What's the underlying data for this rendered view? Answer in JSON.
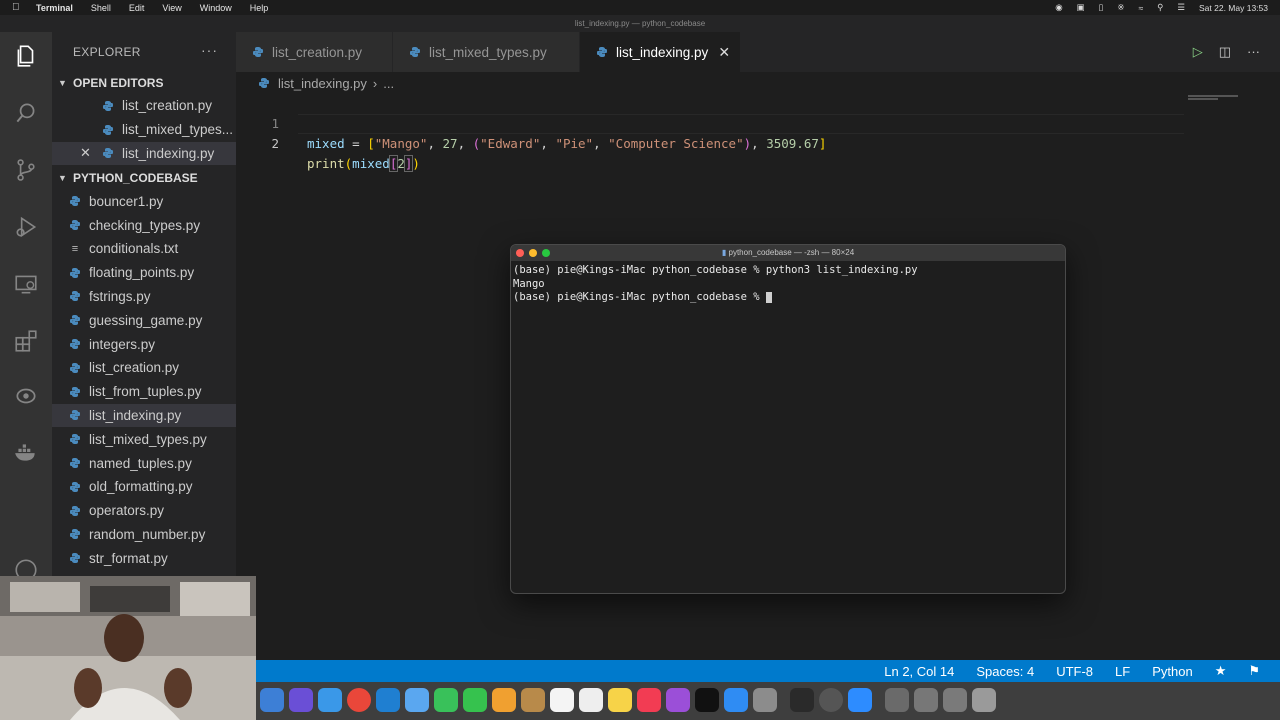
{
  "menubar": {
    "app_name": "Terminal",
    "items": [
      "Shell",
      "Edit",
      "View",
      "Window",
      "Help"
    ],
    "datetime": "Sat 22. May  13:53"
  },
  "window_title": "list_indexing.py — python_codebase",
  "sidebar": {
    "header": "EXPLORER",
    "open_editors_label": "OPEN EDITORS",
    "open_editors": [
      "list_creation.py",
      "list_mixed_types...",
      "list_indexing.py"
    ],
    "folder_label": "PYTHON_CODEBASE",
    "files": [
      {
        "name": "bouncer1.py",
        "icon": "python-icon"
      },
      {
        "name": "checking_types.py",
        "icon": "python-icon"
      },
      {
        "name": "conditionals.txt",
        "icon": "text-file-icon"
      },
      {
        "name": "floating_points.py",
        "icon": "python-icon"
      },
      {
        "name": "fstrings.py",
        "icon": "python-icon"
      },
      {
        "name": "guessing_game.py",
        "icon": "python-icon"
      },
      {
        "name": "integers.py",
        "icon": "python-icon"
      },
      {
        "name": "list_creation.py",
        "icon": "python-icon"
      },
      {
        "name": "list_from_tuples.py",
        "icon": "python-icon"
      },
      {
        "name": "list_indexing.py",
        "icon": "python-icon"
      },
      {
        "name": "list_mixed_types.py",
        "icon": "python-icon"
      },
      {
        "name": "named_tuples.py",
        "icon": "python-icon"
      },
      {
        "name": "old_formatting.py",
        "icon": "python-icon"
      },
      {
        "name": "operators.py",
        "icon": "python-icon"
      },
      {
        "name": "random_number.py",
        "icon": "python-icon"
      },
      {
        "name": "str_format.py",
        "icon": "python-icon"
      }
    ]
  },
  "tabs": [
    {
      "label": "list_creation.py"
    },
    {
      "label": "list_mixed_types.py"
    },
    {
      "label": "list_indexing.py"
    }
  ],
  "breadcrumb": {
    "file": "list_indexing.py",
    "rest": "..."
  },
  "editor": {
    "line_numbers": [
      "1",
      "2"
    ],
    "l1": {
      "var": "mixed",
      "eq": " = ",
      "ob": "[",
      "s1": "\"Mango\"",
      "c1": ", ",
      "n1": "27",
      "c2": ", ",
      "op": "(",
      "s2": "\"Edward\"",
      "c3": ", ",
      "s3": "\"Pie\"",
      "c4": ", ",
      "s4": "\"Computer Science\"",
      "cp": ")",
      "c5": ", ",
      "n2": "3509.67",
      "cb": "]"
    },
    "l2": {
      "fn": "print",
      "op": "(",
      "var": "mixed",
      "ob": "[",
      "num": "2",
      "cb": "]",
      "cp": ")"
    }
  },
  "terminal": {
    "title": "python_codebase — -zsh — 80×24",
    "lines": [
      "(base) pie@Kings-iMac python_codebase % python3 list_indexing.py",
      "Mango",
      "(base) pie@Kings-iMac python_codebase % "
    ]
  },
  "status": {
    "position": "Ln 2, Col 14",
    "spaces": "Spaces: 4",
    "encoding": "UTF-8",
    "eol": "LF",
    "language": "Python"
  },
  "colors": {
    "statusbar": "#007acc",
    "activity_bar": "#333333",
    "sidebar": "#252526",
    "editor_bg": "#1e1e1e"
  }
}
